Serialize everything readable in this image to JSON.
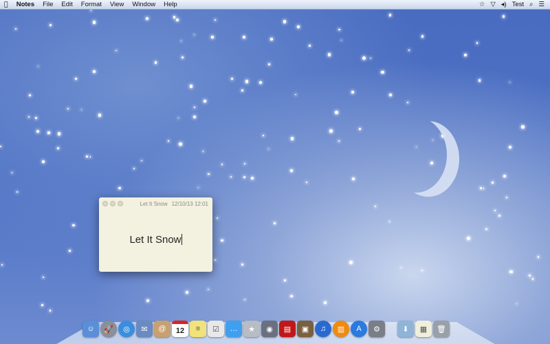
{
  "menubar": {
    "app": "Notes",
    "items": [
      "File",
      "Edit",
      "Format",
      "View",
      "Window",
      "Help"
    ],
    "user": "Test"
  },
  "note": {
    "title": "Let It Snow",
    "timestamp": "12/10/13 12:01",
    "body": "Let It Snow"
  },
  "dock": {
    "calendar_day": "12",
    "apps": [
      {
        "name": "finder",
        "color": "#5a8fd8",
        "glyph": "☺"
      },
      {
        "name": "launchpad",
        "color": "#8a8f98",
        "glyph": "🚀"
      },
      {
        "name": "safari",
        "color": "#3a8ee0",
        "glyph": "◎"
      },
      {
        "name": "mail",
        "color": "#6a8ac0",
        "glyph": "✉"
      },
      {
        "name": "contacts",
        "color": "#c9a070",
        "glyph": "@"
      },
      {
        "name": "calendar",
        "color": "#ffffff",
        "glyph": ""
      },
      {
        "name": "notes",
        "color": "#f2e27a",
        "glyph": "≡"
      },
      {
        "name": "reminders",
        "color": "#e8e8e8",
        "glyph": "☑"
      },
      {
        "name": "messages",
        "color": "#3fa0f0",
        "glyph": "…"
      },
      {
        "name": "star-app",
        "color": "#b8bcc4",
        "glyph": "★"
      },
      {
        "name": "facetime",
        "color": "#6a7080",
        "glyph": "◉"
      },
      {
        "name": "photo-booth",
        "color": "#c01818",
        "glyph": "▤"
      },
      {
        "name": "iphoto",
        "color": "#7a6040",
        "glyph": "▣"
      },
      {
        "name": "itunes",
        "color": "#2a6ad0",
        "glyph": "♫"
      },
      {
        "name": "ibooks",
        "color": "#f08a10",
        "glyph": "▥"
      },
      {
        "name": "app-store",
        "color": "#2a7ae0",
        "glyph": "A"
      },
      {
        "name": "system-preferences",
        "color": "#7a7e86",
        "glyph": "⚙"
      }
    ],
    "right": [
      {
        "name": "downloads-folder",
        "color": "#8fb4d8",
        "glyph": "⬇"
      },
      {
        "name": "documents-stack",
        "color": "#f0eedc",
        "glyph": "▦"
      },
      {
        "name": "trash",
        "color": "#9aa0a8",
        "glyph": "🗑"
      }
    ]
  }
}
